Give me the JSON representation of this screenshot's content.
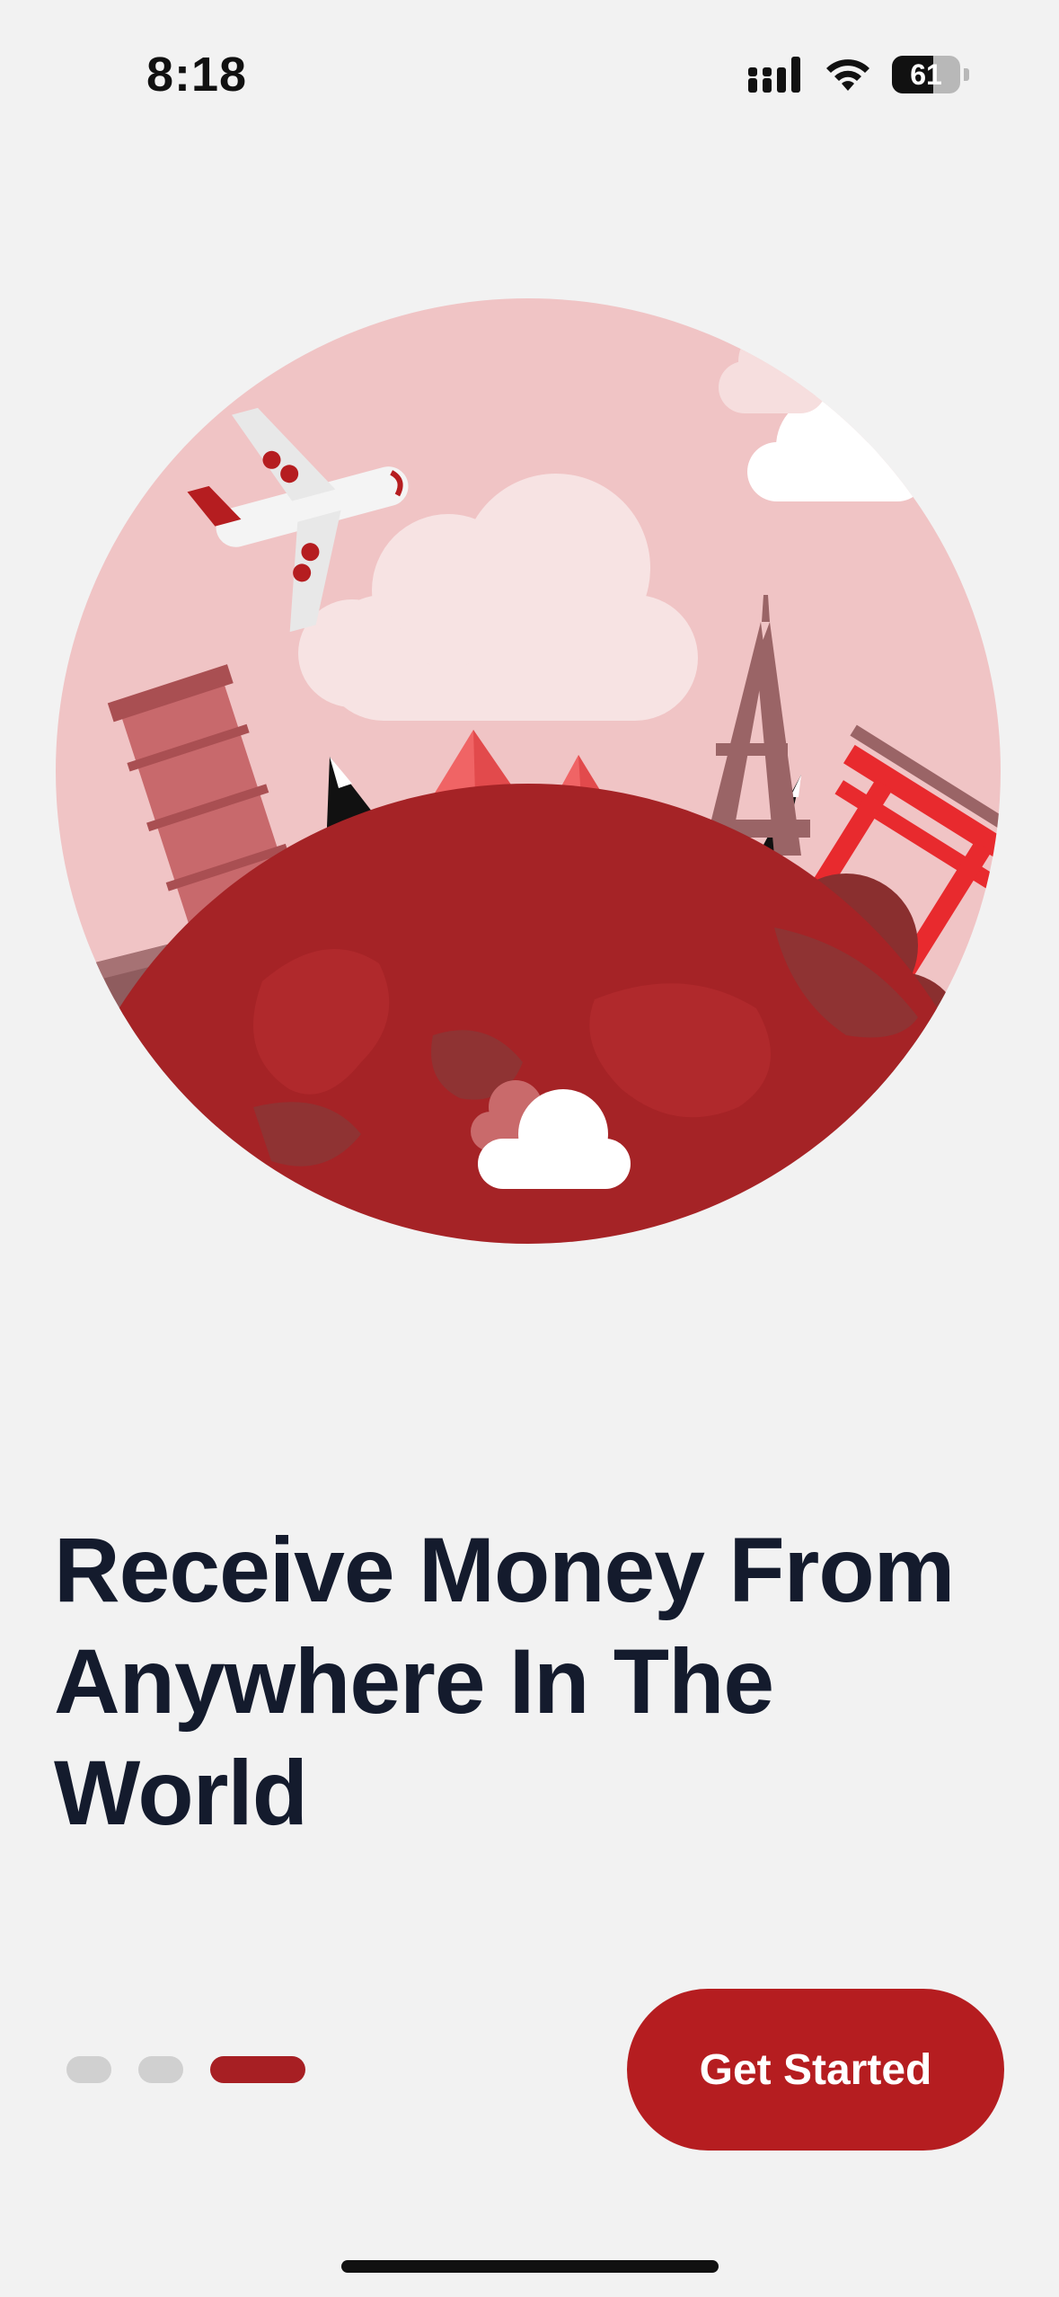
{
  "status_bar": {
    "time": "8:18",
    "battery_level": "61",
    "signal_icon": "cellular-signal-icon",
    "wifi_icon": "wifi-icon",
    "battery_icon": "battery-icon"
  },
  "illustration": {
    "icon": "travel-landmarks-globe-illustration"
  },
  "onboarding": {
    "headline_lines": [
      "Receive Money From",
      "Anywhere In The",
      "World"
    ],
    "current_page": 3,
    "total_pages": 3,
    "cta_label": "Get Started"
  },
  "colors": {
    "background": "#f2f2f2",
    "accent": "#b51d20",
    "headline": "#141b2d",
    "inactive_dot": "#d0d0d0",
    "circle_bg": "#f0c4c5"
  }
}
